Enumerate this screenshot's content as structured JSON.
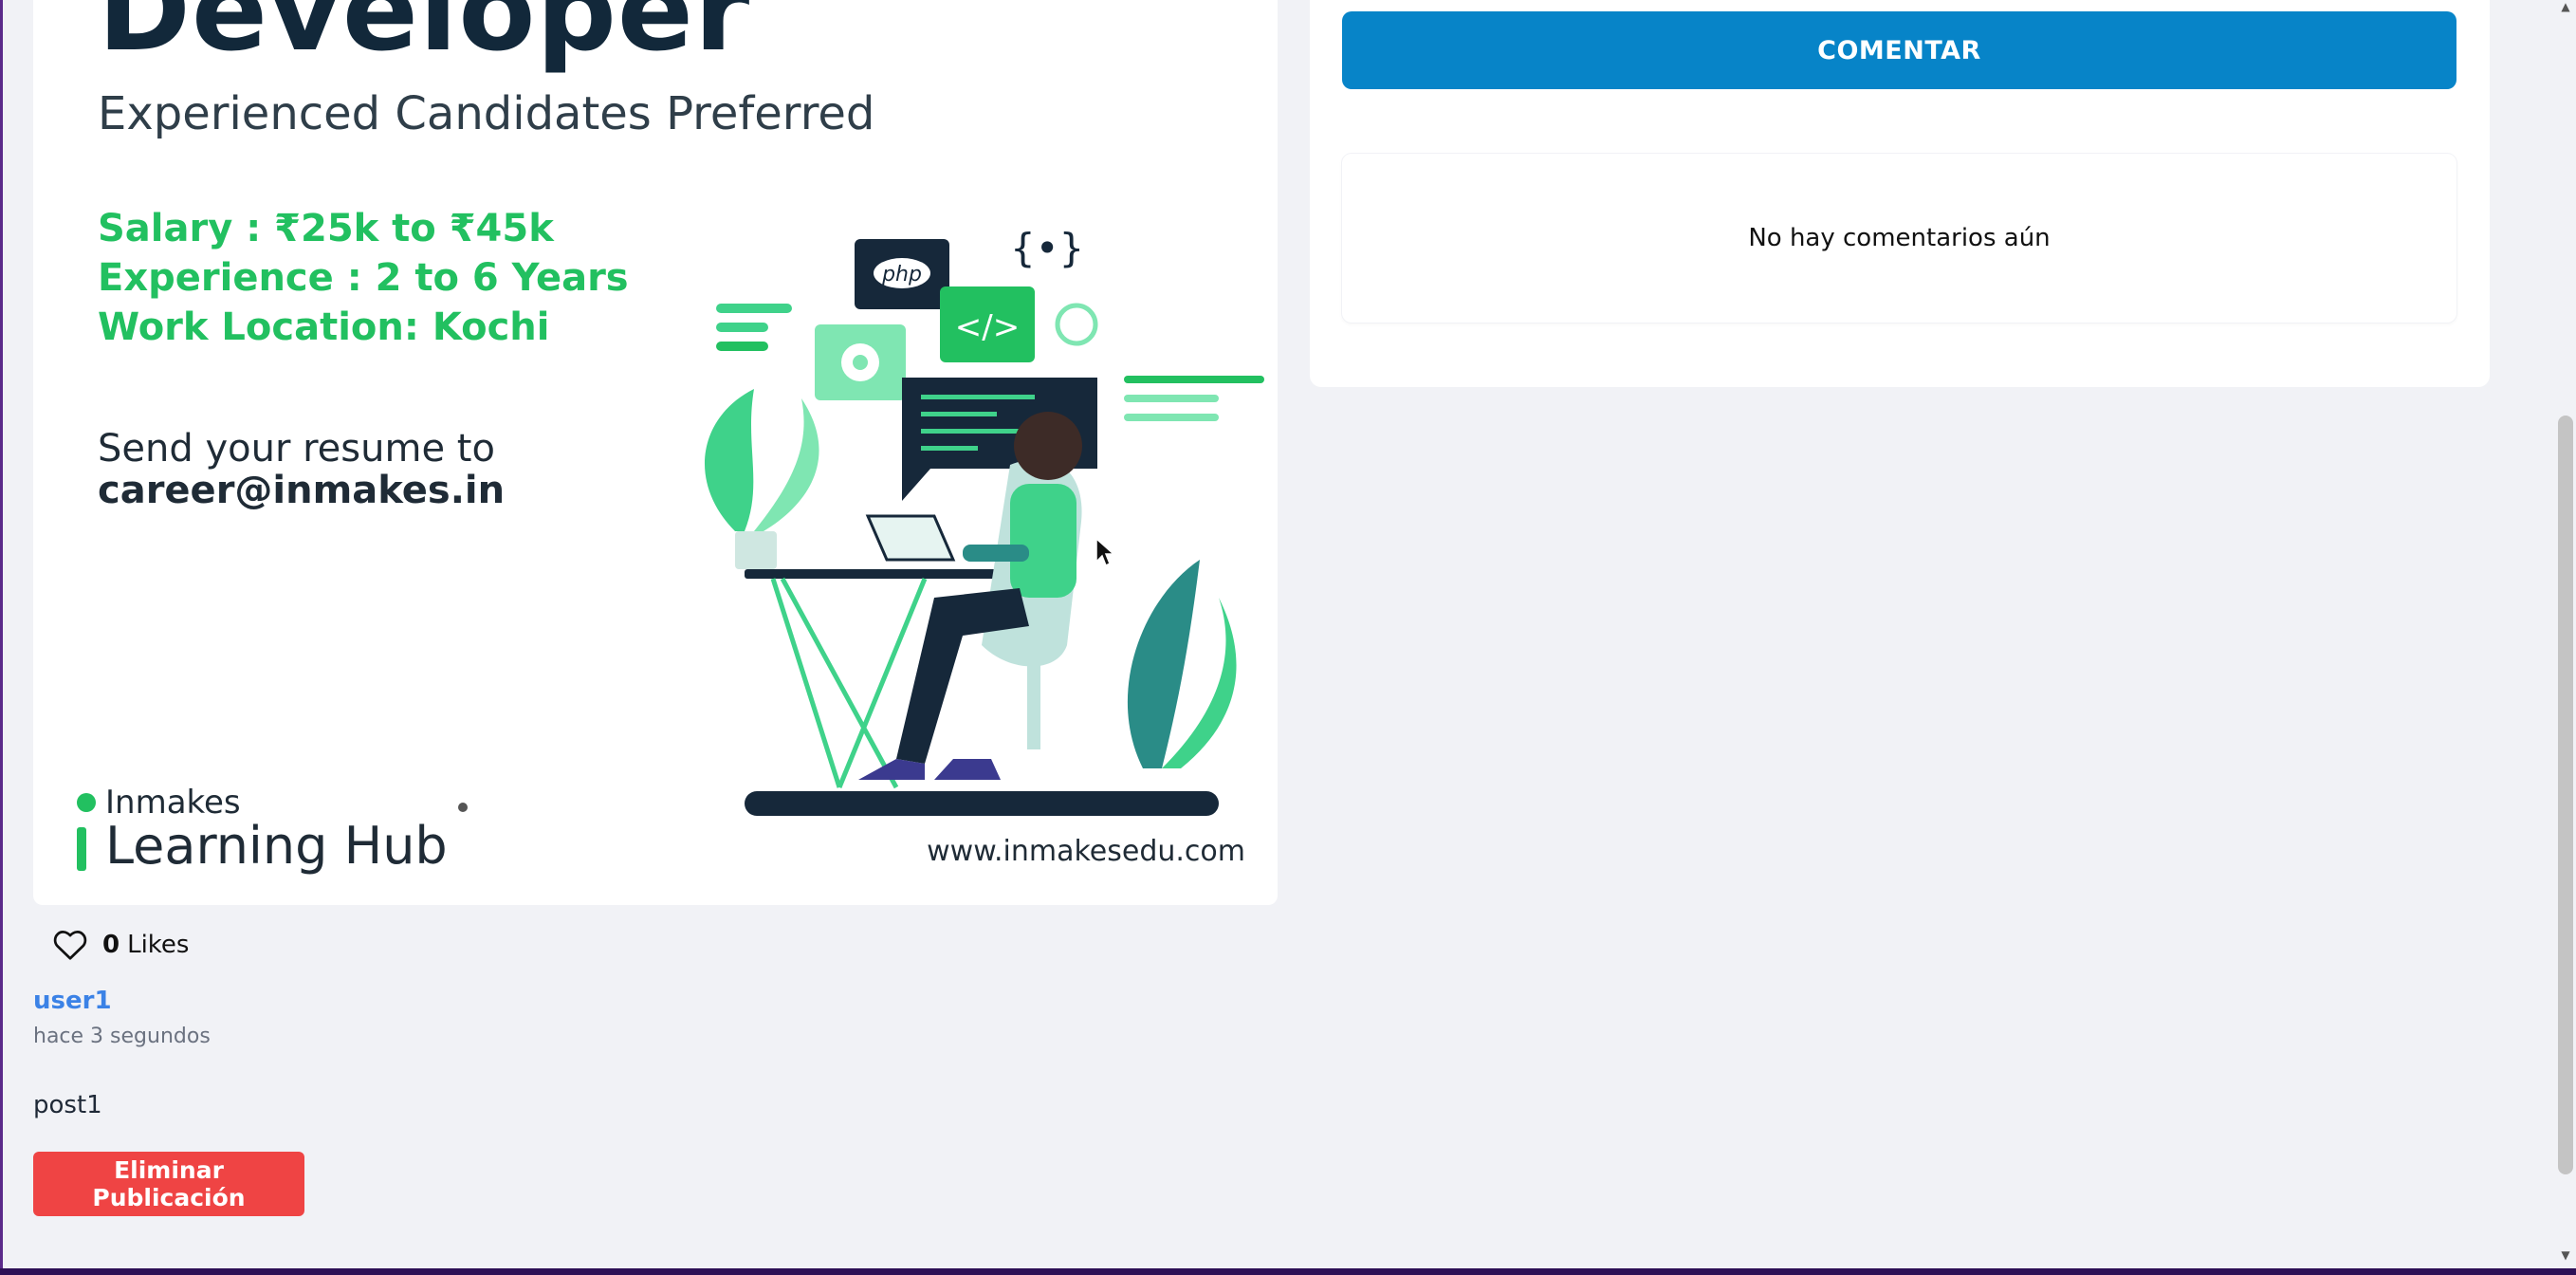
{
  "post": {
    "image": {
      "heading": "Developer",
      "subheading": "Experienced Candidates Preferred",
      "details": [
        "Salary : ₹25k to ₹45k",
        "Experience : 2 to 6 Years",
        "Work Location: Kochi"
      ],
      "send_line": "Send your resume to",
      "email": "career@inmakes.in",
      "logo_small": "Inmakes",
      "logo_big": "Learning Hub",
      "website": "www.inmakesedu.com",
      "illustration_labels": {
        "php": "php",
        "code": "</>",
        "braces": "{•}"
      }
    },
    "likes": {
      "count": "0",
      "label": "Likes"
    },
    "username": "user1",
    "timestamp": "hace 3 segundos",
    "text": "post1",
    "delete_label": "Eliminar Publicación"
  },
  "comments": {
    "button_label": "COMENTAR",
    "empty_text": "No hay comentarios aún"
  },
  "colors": {
    "accent_blue": "#0784c8",
    "danger_red": "#ef4444",
    "link_blue": "#3b82e6",
    "green": "#22c060",
    "page_bg": "#f1f2f6"
  }
}
